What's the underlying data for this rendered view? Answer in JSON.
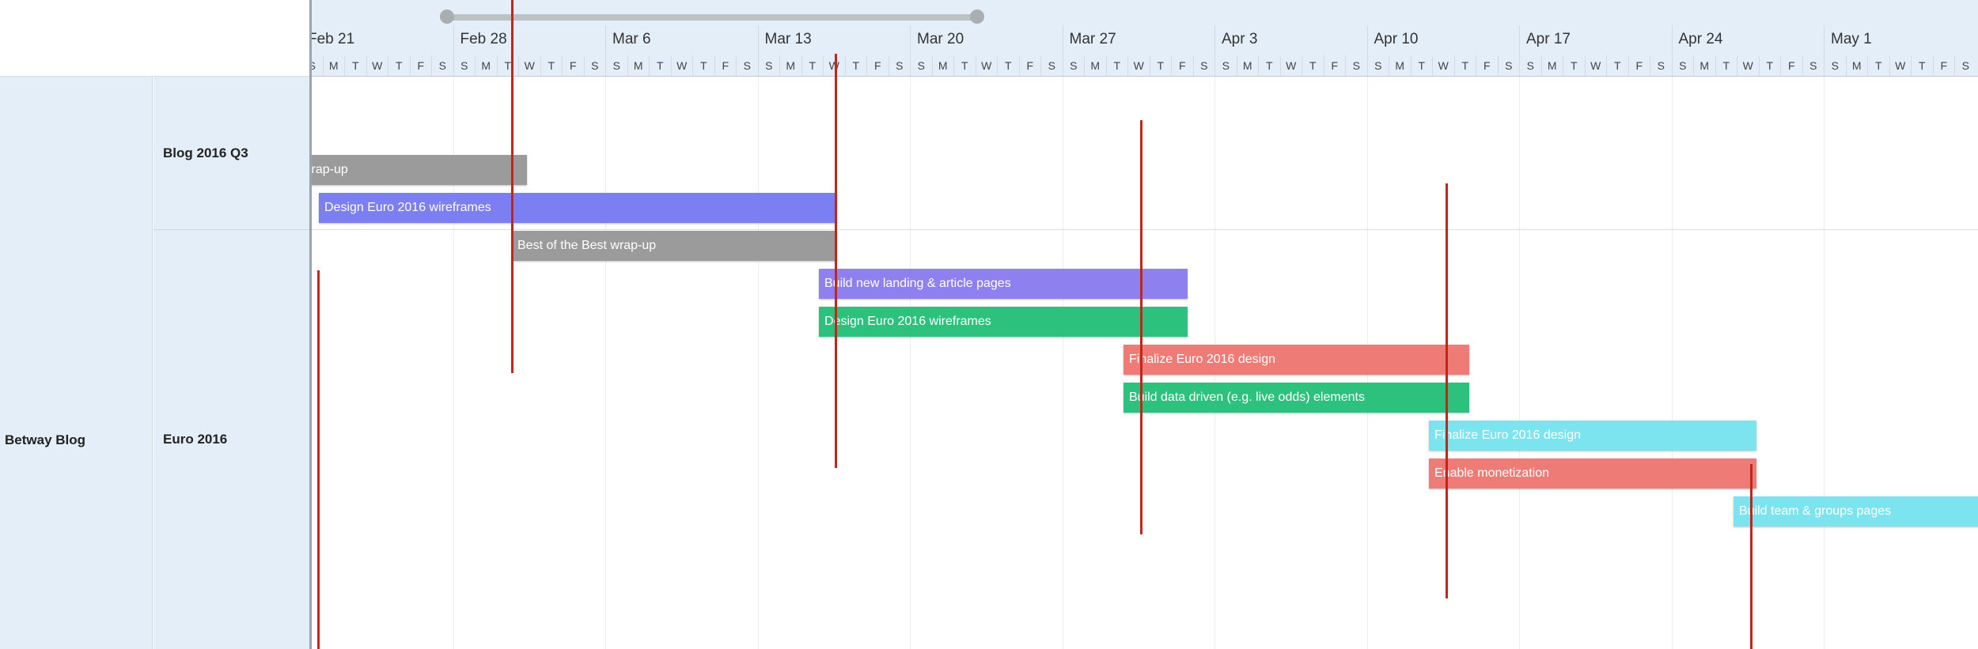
{
  "groups": [
    {
      "label": "Betway Blog"
    }
  ],
  "subgroups": [
    {
      "label": "Blog 2016 Q3"
    },
    {
      "label": "Euro 2016"
    }
  ],
  "weeks": [
    "Feb 21",
    "Feb 28",
    "Mar 6",
    "Mar 13",
    "Mar 20",
    "Mar 27",
    "Apr 3",
    "Apr 10",
    "Apr 17",
    "Apr 24",
    "May 1"
  ],
  "weekday_letters": [
    "S",
    "M",
    "T",
    "W",
    "T",
    "F",
    "S"
  ],
  "tasks": [
    {
      "label": "wrap-up",
      "color": "#9b9b9b"
    },
    {
      "label": "Design Euro 2016 wireframes",
      "color": "#7b7ff2"
    },
    {
      "label": "Best of the Best wrap-up",
      "color": "#9b9b9b"
    },
    {
      "label": "Build new landing & article pages",
      "color": "#8f80ef"
    },
    {
      "label": "Design Euro 2016 wireframes",
      "color": "#2cc17d"
    },
    {
      "label": "Finalize Euro 2016 design",
      "color": "#ef7b76"
    },
    {
      "label": "Build data driven (e.g. live odds) elements",
      "color": "#2cc17d"
    },
    {
      "label": "Finalize Euro 2016 design",
      "color": "#7ce4ee"
    },
    {
      "label": "Enable monetization",
      "color": "#ef7b76"
    },
    {
      "label": "Build team & groups pages",
      "color": "#7ce4ee"
    }
  ],
  "colors": {
    "panel_bg": "#e4eef8",
    "marker": "#c0261c"
  }
}
